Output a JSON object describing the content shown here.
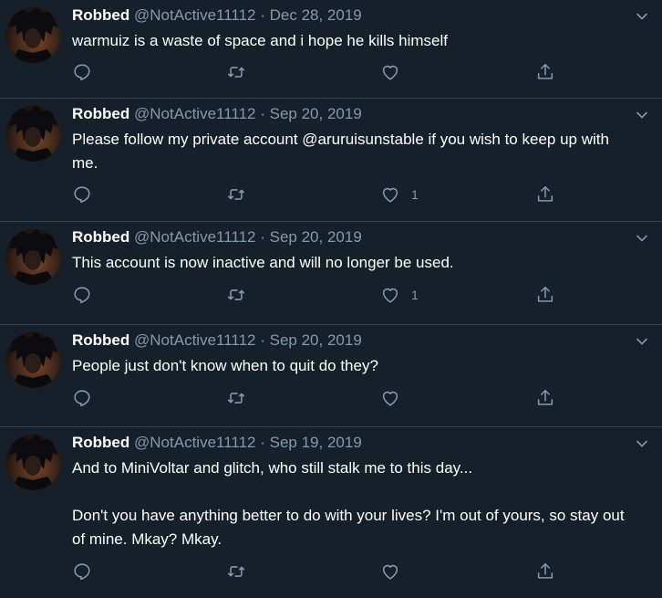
{
  "tweets": [
    {
      "name": "Robbed",
      "handle": "@NotActive11112",
      "date": "Dec 28, 2019",
      "text": "warmuiz is a waste of space and i hope he kills himself",
      "likes": ""
    },
    {
      "name": "Robbed",
      "handle": "@NotActive11112",
      "date": "Sep 20, 2019",
      "text": "Please follow my private account @aruruisunstable if you wish to keep up with me.",
      "likes": "1"
    },
    {
      "name": "Robbed",
      "handle": "@NotActive11112",
      "date": "Sep 20, 2019",
      "text": "This account is now inactive and will no longer be used.",
      "likes": "1"
    },
    {
      "name": "Robbed",
      "handle": "@NotActive11112",
      "date": "Sep 20, 2019",
      "text": "People just don't know when to quit do they?",
      "likes": ""
    },
    {
      "name": "Robbed",
      "handle": "@NotActive11112",
      "date": "Sep 19, 2019",
      "text": "And to MiniVoltar and glitch, who still stalk me to this day...\n\nDon't you have anything better to do with your lives? I'm out of yours, so stay out of mine. Mkay? Mkay.",
      "likes": ""
    }
  ],
  "separator": " · ",
  "icons": {
    "reply": "reply-icon",
    "retweet": "retweet-icon",
    "like": "heart-icon",
    "share": "share-icon",
    "more": "chevron-down-icon"
  },
  "colors": {
    "background": "#15202b",
    "text": "#ffffff",
    "secondary": "#8899a6",
    "border": "#38444d"
  }
}
